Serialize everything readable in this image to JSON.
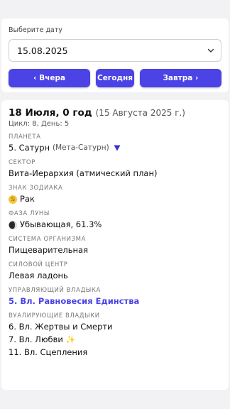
{
  "date_picker": {
    "label": "Выберите дату",
    "selected_date": "15.08.2025",
    "prev_label": "‹ Вчера",
    "today_label": "Сегодня",
    "next_label": "Завтра ›"
  },
  "info": {
    "title": "18 Июля, 0 год",
    "subtitle": "(15 Августа 2025 г.)",
    "cycle": "Цикл: 8, День: 5",
    "planet": {
      "label": "ПЛАНЕТА",
      "value": "5. Сатурн",
      "extra": "(Мета-Сатурн)",
      "icon": "triangle-down-icon",
      "icon_color": "#3b2fd6"
    },
    "sector": {
      "label": "СЕКТОР",
      "value": "Вита-Иерархия (атмический план)"
    },
    "zodiac": {
      "label": "ЗНАК ЗОДИАКА",
      "value": "Рак",
      "icon": "cancer-zodiac-icon",
      "icon_glyph": "♋"
    },
    "moon": {
      "label": "ФАЗА ЛУНЫ",
      "value": "Убывающая, 61.3%",
      "icon": "waning-moon-icon"
    },
    "organ_system": {
      "label": "СИСТЕМА ОРГАНИЗМА",
      "value": "Пищеварительная"
    },
    "power_center": {
      "label": "СИЛОВОЙ ЦЕНТР",
      "value": "Левая ладонь"
    },
    "ruling_lord": {
      "label": "УПРАВЛЯЮЩИЙ ВЛАДЫКА",
      "value": "5. Вл. Равновесия Единства",
      "color": "#4b43e6"
    },
    "dual_lords": {
      "label": "ВУАЛИРУЮЩИЕ ВЛАДЫКИ",
      "items": [
        "6. Вл. Жертвы и Смерти",
        "7. Вл. Любви",
        "11. Вл. Сцепления"
      ],
      "item_2_icon": "sparkles-icon",
      "item_2_glyph": "✨"
    }
  }
}
